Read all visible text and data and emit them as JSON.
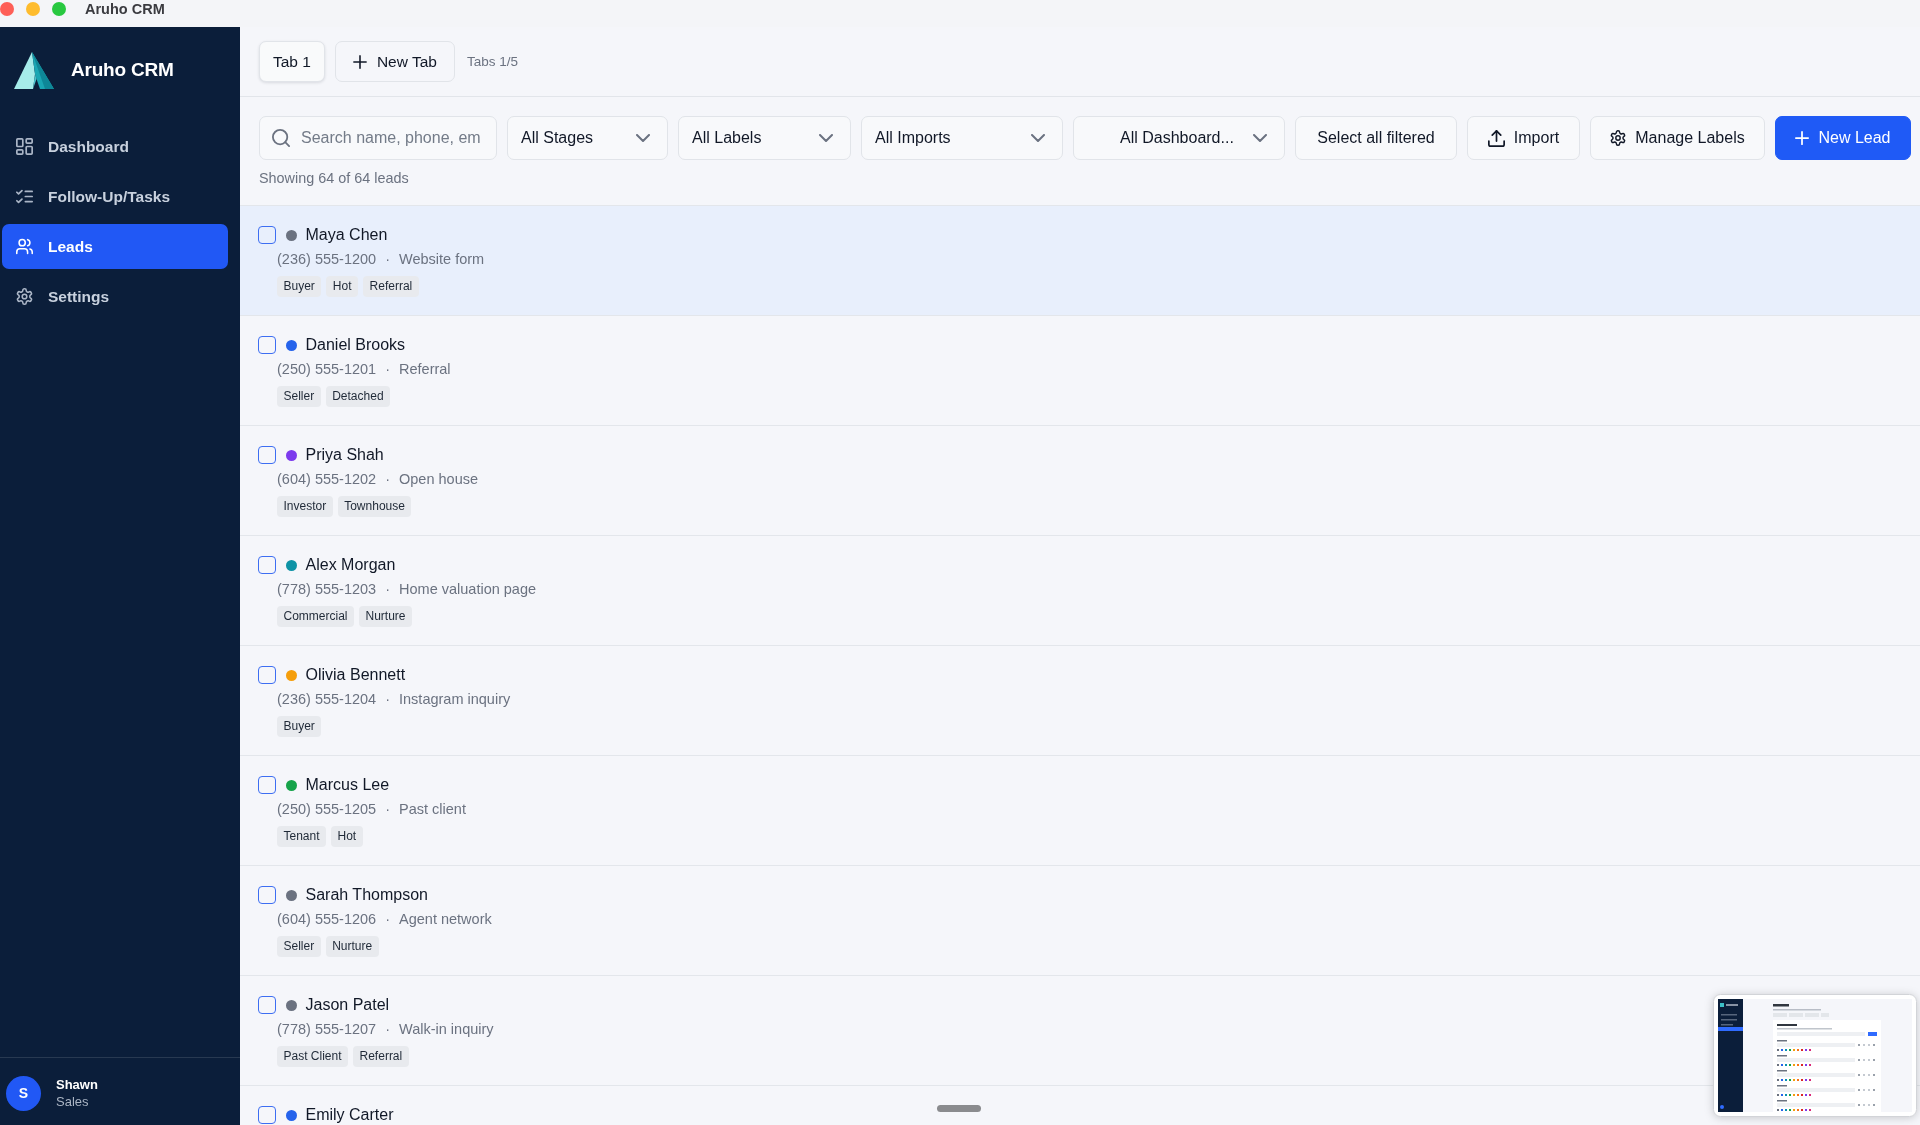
{
  "window": {
    "title": "Aruho CRM"
  },
  "sidebar": {
    "brand": "Aruho CRM",
    "items": [
      {
        "label": "Dashboard",
        "selected": false
      },
      {
        "label": "Follow-Up/Tasks",
        "selected": false
      },
      {
        "label": "Leads",
        "selected": true
      },
      {
        "label": "Settings",
        "selected": false
      }
    ],
    "user": {
      "initial": "S",
      "name": "Shawn",
      "role": "Sales"
    }
  },
  "tabs": {
    "items": [
      {
        "label": "Tab 1",
        "selected": true
      }
    ],
    "new_tab": "New Tab",
    "counter": "Tabs 1/5"
  },
  "toolbar": {
    "search": {
      "placeholder": "Search name, phone, em"
    },
    "filters": [
      {
        "label": "All Stages"
      },
      {
        "label": "All Labels"
      },
      {
        "label": "All Imports"
      },
      {
        "label": "All Dashboard..."
      }
    ],
    "actions": [
      {
        "label": "Select all filtered",
        "kind": "outline"
      },
      {
        "label": "Import",
        "kind": "outline"
      },
      {
        "label": "Manage Labels",
        "kind": "outline"
      },
      {
        "label": "New Lead",
        "kind": "primary"
      }
    ]
  },
  "summary": "Showing 64 of 64 leads",
  "leads": [
    {
      "name": "Maya Chen",
      "color": "#6b7280",
      "phone": "(236) 555-1200",
      "separator": "·",
      "source": "Website form",
      "labels": [
        "Buyer",
        "Hot",
        "Referral"
      ],
      "checked": false,
      "selected": true
    },
    {
      "name": "Daniel Brooks",
      "color": "#2563eb",
      "phone": "(250) 555-1201",
      "separator": "·",
      "source": "Referral",
      "labels": [
        "Seller",
        "Detached"
      ],
      "checked": false,
      "selected": false
    },
    {
      "name": "Priya Shah",
      "color": "#7c3aed",
      "phone": "(604) 555-1202",
      "separator": "·",
      "source": "Open house",
      "labels": [
        "Investor",
        "Townhouse"
      ],
      "checked": false,
      "selected": false
    },
    {
      "name": "Alex Morgan",
      "color": "#0e93a6",
      "phone": "(778) 555-1203",
      "separator": "·",
      "source": "Home valuation page",
      "labels": [
        "Commercial",
        "Nurture"
      ],
      "checked": false,
      "selected": false
    },
    {
      "name": "Olivia Bennett",
      "color": "#f59e0b",
      "phone": "(236) 555-1204",
      "separator": "·",
      "source": "Instagram inquiry",
      "labels": [
        "Buyer"
      ],
      "checked": false,
      "selected": false
    },
    {
      "name": "Marcus Lee",
      "color": "#16a34a",
      "phone": "(250) 555-1205",
      "separator": "·",
      "source": "Past client",
      "labels": [
        "Tenant",
        "Hot"
      ],
      "checked": false,
      "selected": false
    },
    {
      "name": "Sarah Thompson",
      "color": "#6b7280",
      "phone": "(604) 555-1206",
      "separator": "·",
      "source": "Agent network",
      "labels": [
        "Seller",
        "Nurture"
      ],
      "checked": false,
      "selected": false
    },
    {
      "name": "Jason Patel",
      "color": "#6b7280",
      "phone": "(778) 555-1207",
      "separator": "·",
      "source": "Walk-in inquiry",
      "labels": [
        "Past Client",
        "Referral"
      ],
      "checked": false,
      "selected": false
    },
    {
      "name": "Emily Carter",
      "color": "#2563eb",
      "checked": false,
      "selected": false
    }
  ]
}
